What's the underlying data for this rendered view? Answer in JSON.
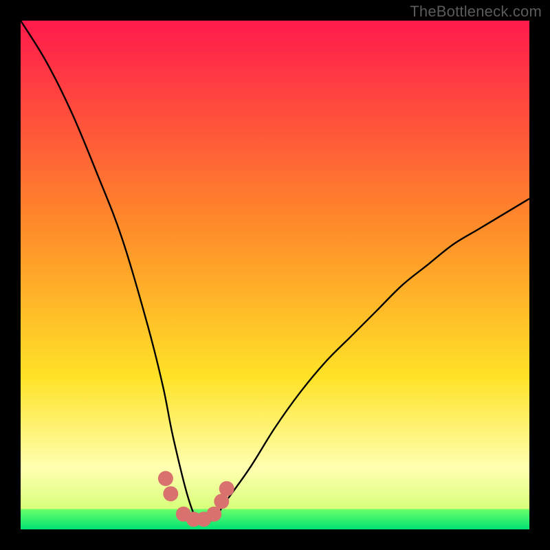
{
  "watermark": "TheBottleneck.com",
  "chart_data": {
    "type": "line",
    "title": "",
    "xlabel": "",
    "ylabel": "",
    "xlim": [
      0,
      100
    ],
    "ylim": [
      0,
      100
    ],
    "grid": false,
    "series": [
      {
        "name": "bottleneck-curve",
        "x": [
          0,
          5,
          10,
          15,
          20,
          25,
          28,
          30,
          33,
          35,
          38,
          40,
          45,
          50,
          55,
          60,
          65,
          70,
          75,
          80,
          85,
          90,
          95,
          100
        ],
        "values": [
          100,
          92,
          82,
          70,
          57,
          40,
          28,
          18,
          6,
          2,
          2,
          5,
          12,
          20,
          27,
          33,
          38,
          43,
          48,
          52,
          56,
          59,
          62,
          65
        ]
      }
    ],
    "markers": {
      "name": "highlight-dots",
      "color": "#d9716e",
      "x": [
        28.5,
        29.5,
        32.0,
        34.0,
        36.0,
        38.0,
        39.5,
        40.5
      ],
      "values": [
        10.0,
        7.0,
        3.0,
        2.0,
        2.0,
        3.0,
        5.5,
        8.0
      ]
    },
    "background_bands": [
      {
        "from": 100,
        "to": 60,
        "top_color": "#ff1a4c",
        "bottom_color": "#ff8a2a"
      },
      {
        "from": 60,
        "to": 30,
        "top_color": "#ff8a2a",
        "bottom_color": "#ffe227"
      },
      {
        "from": 30,
        "to": 12,
        "top_color": "#ffe227",
        "bottom_color": "#ffffb0"
      },
      {
        "from": 12,
        "to": 4,
        "top_color": "#ffffb0",
        "bottom_color": "#d8ff7a"
      },
      {
        "from": 4,
        "to": 0,
        "top_color": "#6aff6a",
        "bottom_color": "#00e273"
      }
    ]
  }
}
